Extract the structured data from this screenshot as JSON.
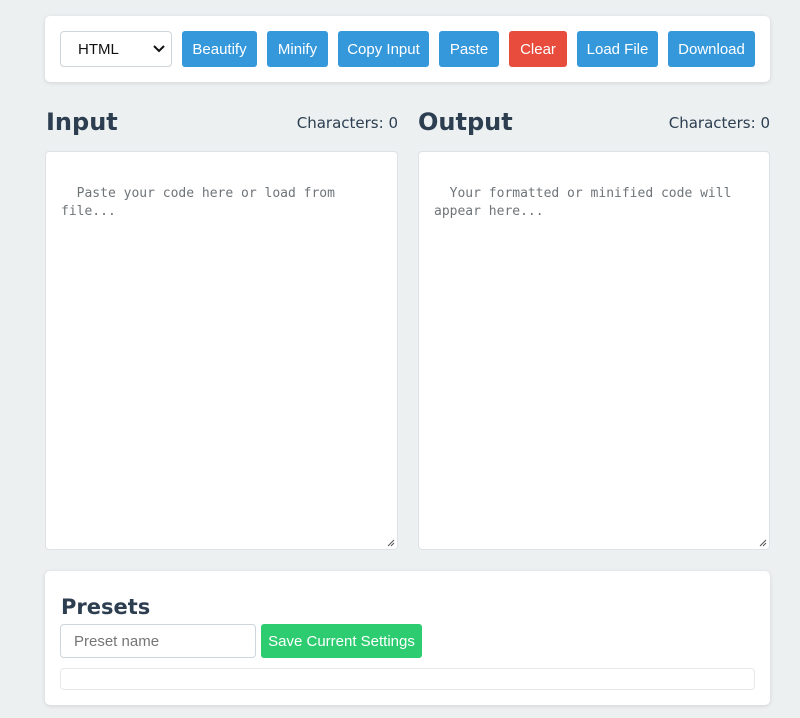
{
  "toolbar": {
    "language": "HTML",
    "buttons": {
      "beautify": "Beautify",
      "minify": "Minify",
      "copy_input": "Copy Input",
      "paste": "Paste",
      "clear": "Clear",
      "load_file": "Load File",
      "download": "Download"
    }
  },
  "input_panel": {
    "title": "Input",
    "char_count": "Characters: 0",
    "placeholder": "Paste your code here or load from file..."
  },
  "output_panel": {
    "title": "Output",
    "char_count": "Characters: 0",
    "placeholder": "Your formatted or minified code will appear here..."
  },
  "presets": {
    "title": "Presets",
    "name_placeholder": "Preset name",
    "save_label": "Save Current Settings"
  },
  "colors": {
    "primary": "#3498db",
    "danger": "#e74c3c",
    "success": "#2ecc71",
    "background": "#ecf0f1",
    "heading": "#2c3e50"
  }
}
